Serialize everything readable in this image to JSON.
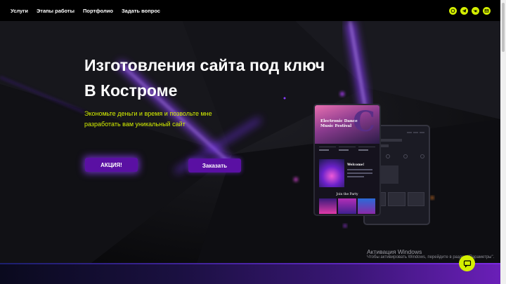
{
  "nav": {
    "links": [
      "Услуги",
      "Этапы работы",
      "Портфолио",
      "Задать вопрос"
    ],
    "social_icons": [
      "whatsapp-icon",
      "telegram-icon",
      "vk-icon",
      "email-icon"
    ]
  },
  "hero": {
    "title_line1": "Изготовления сайта под ключ",
    "title_line2": "В Костроме",
    "subtitle": "Экономьте деньги и время и позвольте мне разработать вам уникальный сайт",
    "promo_button": "АКЦИЯ!",
    "order_button": "Заказать"
  },
  "mockup": {
    "title": "Electronic Dance Music Festival",
    "big_letter": "C",
    "welcome": "Welcome!",
    "party": "Join the Party"
  },
  "watermark": {
    "title": "Активация Windows",
    "subtitle": "Чтобы активировать Windows, перейдите в раздел \"Параметры\"."
  },
  "colors": {
    "accent": "#d5f000",
    "button": "#5a10a3",
    "glow": "#8c3cff",
    "background": "#0c0c0f"
  }
}
